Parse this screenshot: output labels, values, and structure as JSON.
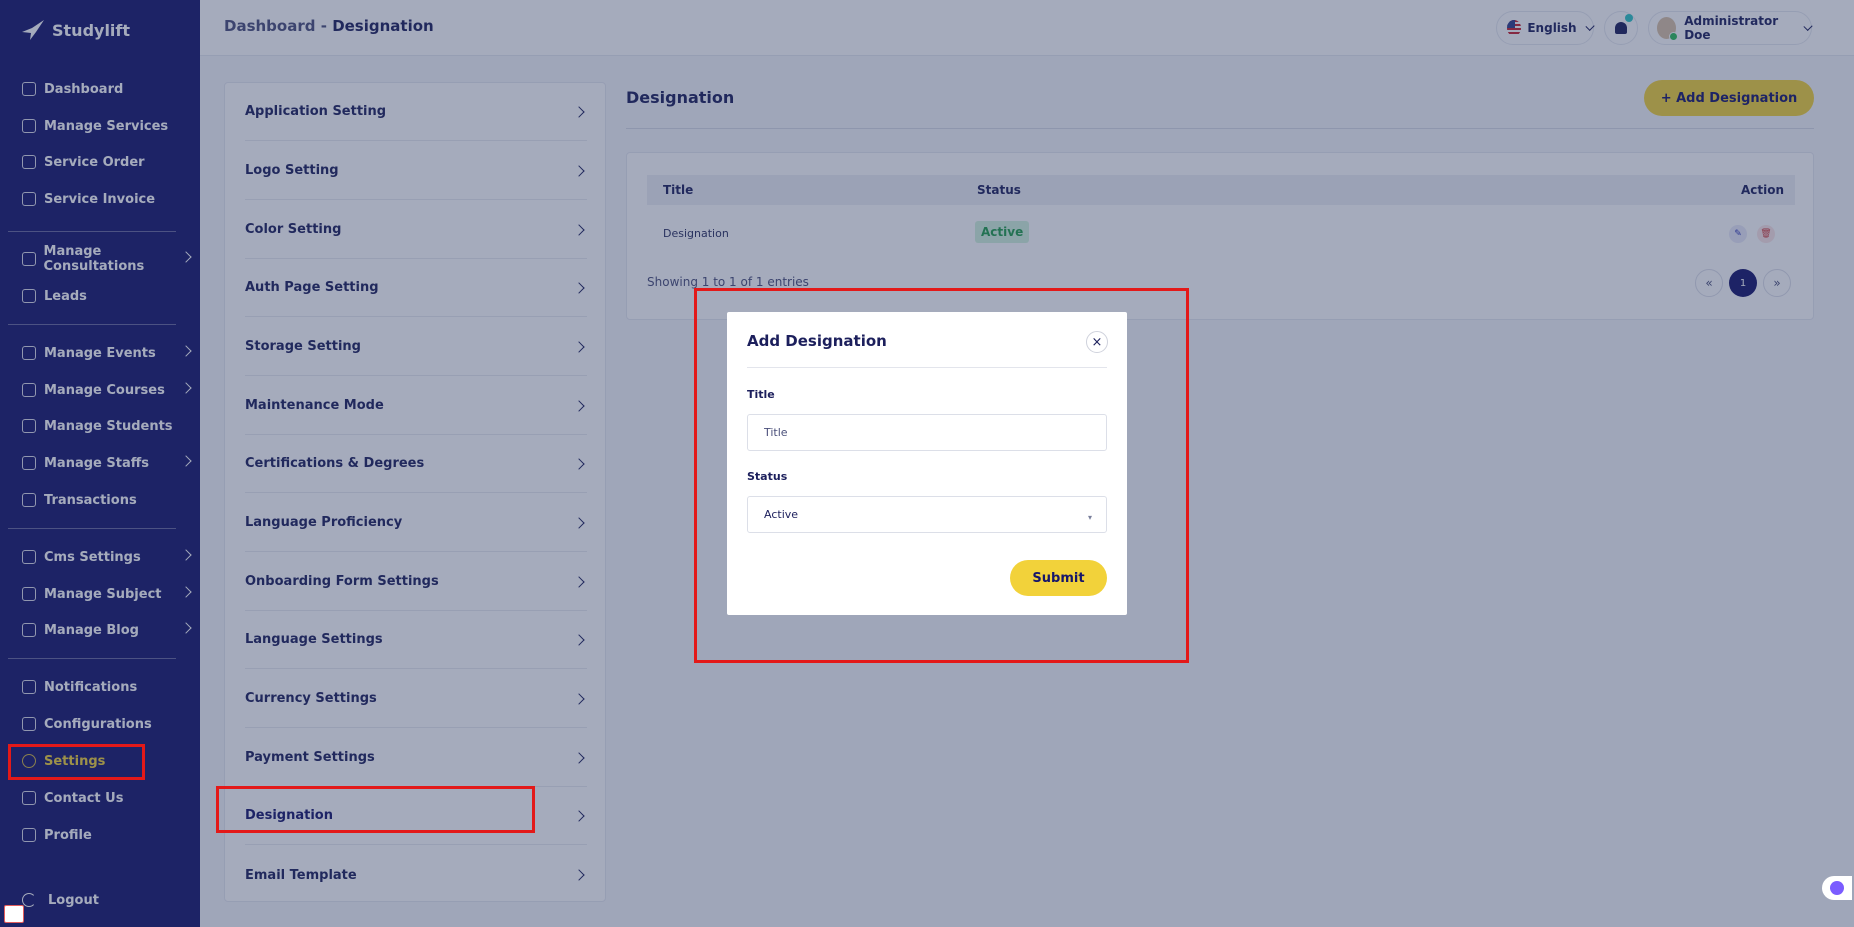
{
  "app": {
    "brand": "Studylift"
  },
  "sidebar": {
    "items": [
      {
        "label": "Dashboard",
        "icon": "dashboard-icon"
      },
      {
        "label": "Manage Services",
        "icon": "services-icon"
      },
      {
        "label": "Service Order",
        "icon": "order-icon"
      },
      {
        "label": "Service Invoice",
        "icon": "invoice-icon"
      },
      {
        "label": "Manage Consultations",
        "icon": "consultation-icon"
      },
      {
        "label": "Leads",
        "icon": "leads-icon"
      },
      {
        "label": "Manage Events",
        "icon": "calendar-icon"
      },
      {
        "label": "Manage Courses",
        "icon": "courses-icon"
      },
      {
        "label": "Manage Students",
        "icon": "students-icon"
      },
      {
        "label": "Manage Staffs",
        "icon": "staffs-icon"
      },
      {
        "label": "Transactions",
        "icon": "transactions-icon"
      },
      {
        "label": "Cms Settings",
        "icon": "cms-icon"
      },
      {
        "label": "Manage Subject",
        "icon": "subject-icon"
      },
      {
        "label": "Manage Blog",
        "icon": "blog-icon"
      },
      {
        "label": "Notifications",
        "icon": "bell-icon"
      },
      {
        "label": "Configurations",
        "icon": "config-icon"
      },
      {
        "label": "Settings",
        "icon": "gear-icon"
      },
      {
        "label": "Contact Us",
        "icon": "contact-icon"
      },
      {
        "label": "Profile",
        "icon": "user-icon"
      }
    ],
    "logout": "Logout"
  },
  "header": {
    "breadcrumb_root": "Dashboard",
    "breadcrumb_sep": "-",
    "breadcrumb_current": "Designation",
    "language": "English",
    "user_name": "Administrator Doe"
  },
  "settings_menu": [
    "Application Setting",
    "Logo Setting",
    "Color Setting",
    "Auth Page Setting",
    "Storage Setting",
    "Maintenance Mode",
    "Certifications & Degrees",
    "Language Proficiency",
    "Onboarding Form Settings",
    "Language Settings",
    "Currency Settings",
    "Payment Settings",
    "Designation",
    "Email Template"
  ],
  "main": {
    "title": "Designation",
    "add_button": "+ Add Designation",
    "table": {
      "headers": {
        "title": "Title",
        "status": "Status",
        "action": "Action"
      },
      "rows": [
        {
          "title": "Designation",
          "status": "Active"
        }
      ],
      "showing": "Showing 1 to 1 of 1 entries",
      "pagination": {
        "prev": "«",
        "current": "1",
        "next": "»"
      }
    }
  },
  "modal": {
    "title": "Add Designation",
    "close": "×",
    "title_label": "Title",
    "title_placeholder": "Title",
    "status_label": "Status",
    "status_value": "Active",
    "submit": "Submit"
  },
  "colors": {
    "sidebar": "#16166b",
    "accent": "#f2d23a",
    "highlight": "#e31919",
    "active_status": "#1f9e4b"
  }
}
